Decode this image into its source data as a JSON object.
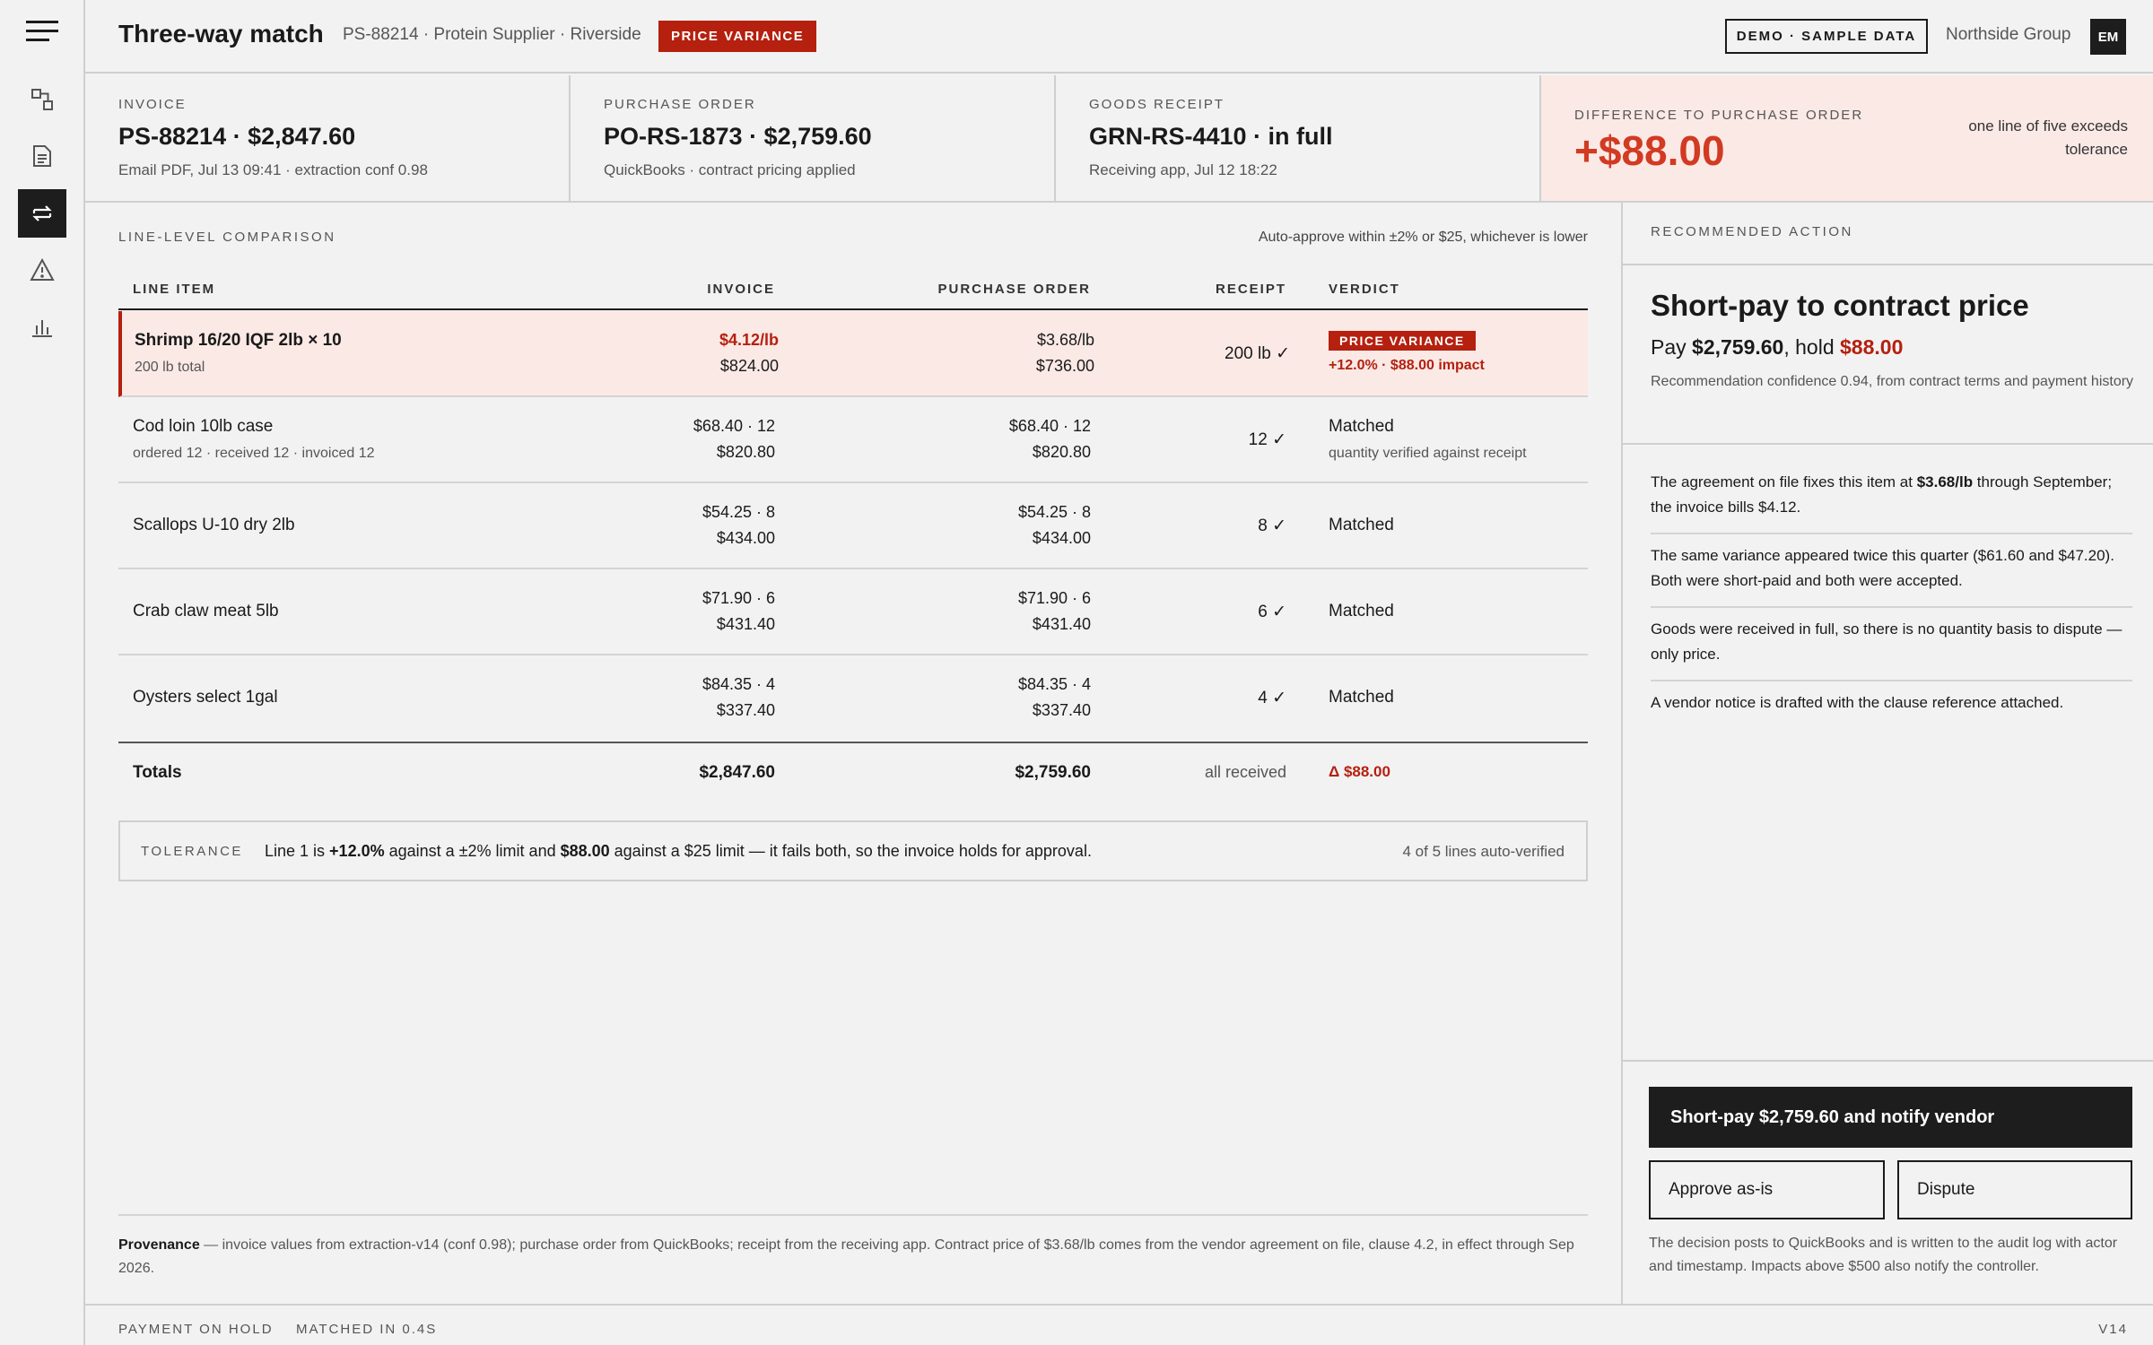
{
  "sidebar": {
    "icons": [
      "menu-icon",
      "workflow-icon",
      "document-icon",
      "match-icon",
      "alert-icon",
      "chart-icon"
    ],
    "active": "match-icon"
  },
  "header": {
    "title": "Three-way match",
    "subtitle": "PS-88214 · Protein Supplier · Riverside",
    "status_badge": "PRICE VARIANCE",
    "demo_badge": "DEMO · SAMPLE DATA",
    "org": "Northside Group",
    "avatar": "EM"
  },
  "summary": {
    "invoice": {
      "label": "INVOICE",
      "value": "PS-88214 · $2,847.60",
      "meta": "Email PDF, Jul 13 09:41 · extraction conf 0.98"
    },
    "purchase_order": {
      "label": "PURCHASE ORDER",
      "value": "PO-RS-1873 · $2,759.60",
      "meta": "QuickBooks · contract pricing applied"
    },
    "goods_receipt": {
      "label": "GOODS RECEIPT",
      "value": "GRN-RS-4410 · in full",
      "meta": "Receiving app, Jul 12 18:22"
    },
    "difference": {
      "label": "DIFFERENCE TO PURCHASE ORDER",
      "value": "+$88.00",
      "note": "one line of five exceeds tolerance"
    }
  },
  "comparison": {
    "section_label": "LINE-LEVEL COMPARISON",
    "rule": "Auto-approve within ±2% or $25, whichever is lower",
    "columns": {
      "item": "LINE ITEM",
      "invoice": "INVOICE",
      "po": "PURCHASE ORDER",
      "receipt": "RECEIPT",
      "verdict": "VERDICT"
    },
    "rows": [
      {
        "name": "Shrimp 16/20 IQF 2lb × 10",
        "meta": "200 lb total",
        "inv_unit": "$4.12/lb",
        "inv_total": "$824.00",
        "po_unit": "$3.68/lb",
        "po_total": "$736.00",
        "receipt": "200 lb ✓",
        "verdict": "PRICE VARIANCE",
        "verdict_meta": "+12.0% · $88.00 impact"
      },
      {
        "name": "Cod loin 10lb case",
        "meta": "ordered 12 · received 12 · invoiced 12",
        "inv_unit": "$68.40 · 12",
        "inv_total": "$820.80",
        "po_unit": "$68.40 · 12",
        "po_total": "$820.80",
        "receipt": "12 ✓",
        "verdict": "Matched",
        "verdict_meta": "quantity verified against receipt"
      },
      {
        "name": "Scallops U-10 dry 2lb",
        "inv_unit": "$54.25 · 8",
        "inv_total": "$434.00",
        "po_unit": "$54.25 · 8",
        "po_total": "$434.00",
        "receipt": "8 ✓",
        "verdict": "Matched"
      },
      {
        "name": "Crab claw meat 5lb",
        "inv_unit": "$71.90 · 6",
        "inv_total": "$431.40",
        "po_unit": "$71.90 · 6",
        "po_total": "$431.40",
        "receipt": "6 ✓",
        "verdict": "Matched"
      },
      {
        "name": "Oysters select 1gal",
        "inv_unit": "$84.35 · 4",
        "inv_total": "$337.40",
        "po_unit": "$84.35 · 4",
        "po_total": "$337.40",
        "receipt": "4 ✓",
        "verdict": "Matched"
      }
    ],
    "totals": {
      "label": "Totals",
      "invoice": "$2,847.60",
      "po": "$2,759.60",
      "receipt": "all received",
      "verdict": "Δ $88.00"
    }
  },
  "tolerance": {
    "label": "TOLERANCE",
    "t1": "Line 1 is ",
    "b1": "+12.0%",
    "t2": " against a ±2% limit and ",
    "b2": "$88.00",
    "t3": " against a $25 limit — it fails both, so the invoice holds for approval.",
    "count": "4 of 5 lines auto-verified"
  },
  "provenance": {
    "label": "Provenance",
    "text": " — invoice values from extraction-v14 (conf 0.98); purchase order from QuickBooks; receipt from the receiving app. Contract price of $3.68/lb comes from the vendor agreement on file, clause 4.2, in effect through Sep 2026."
  },
  "recommendation": {
    "section_label": "RECOMMENDED ACTION",
    "title": "Short-pay to contract price",
    "pay_prefix": "Pay ",
    "pay_amount": "$2,759.60",
    "hold_prefix": ", hold ",
    "hold_amount": "$88.00",
    "confidence": "Recommendation confidence 0.94, from contract terms and payment history",
    "r1a": "The agreement on file fixes this item at ",
    "r1b": "$3.68/lb",
    "r1c": " through September; the invoice bills $4.12.",
    "r2": "The same variance appeared twice this quarter ($61.60 and $47.20). Both were short-paid and both were accepted.",
    "r3": "Goods were received in full, so there is no quantity basis to dispute — only price.",
    "r4": "A vendor notice is drafted with the clause reference attached.",
    "primary_button": "Short-pay $2,759.60 and notify vendor",
    "approve_button": "Approve as-is",
    "dispute_button": "Dispute",
    "footnote": "The decision posts to QuickBooks and is written to the audit log with actor and timestamp. Impacts above $500 also notify the controller."
  },
  "footer": {
    "status": "PAYMENT ON HOLD",
    "matched": "MATCHED IN 0.4S",
    "version": "V14"
  },
  "colors": {
    "accent_red": "#b5200f",
    "diff_red": "#d23a22",
    "flag_bg": "#fbe9e6",
    "dark": "#1d1d1d"
  }
}
